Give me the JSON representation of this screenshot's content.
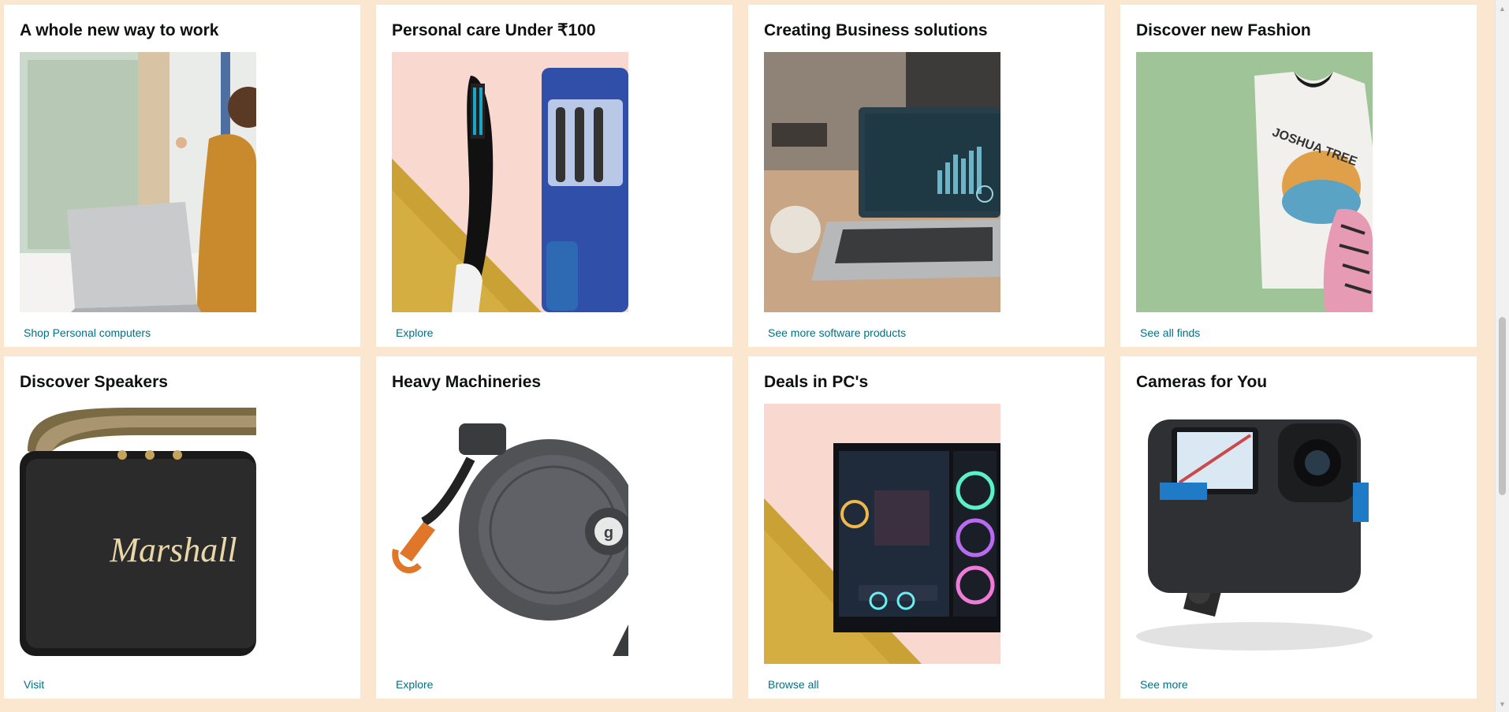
{
  "cards": [
    {
      "title": "A whole new way to work",
      "link": "Shop Personal computers",
      "image": "woman-working-on-laptop"
    },
    {
      "title": "Personal care Under ₹100",
      "link": "Explore",
      "image": "oral-b-toothbrush"
    },
    {
      "title": "Creating Business solutions",
      "link": "See more software products",
      "image": "laptop-with-dashboard"
    },
    {
      "title": "Discover new Fashion",
      "link": "See all finds",
      "image": "graphic-tshirt"
    },
    {
      "title": "Discover Speakers",
      "link": "Visit",
      "image": "marshall-speaker",
      "image_text": "Marshall"
    },
    {
      "title": "Heavy Machineries",
      "link": "Explore",
      "image": "hose-reel"
    },
    {
      "title": "Deals in PC's",
      "link": "Browse all",
      "image": "gaming-pc-case"
    },
    {
      "title": "Cameras for You",
      "link": "See more",
      "image": "action-camera"
    }
  ],
  "colors": {
    "page_background": "#fbe6cf",
    "card_background": "#ffffff",
    "link": "#007185",
    "title": "#0f1111"
  },
  "scrollbar": {
    "up_icon": "triangle-up-icon",
    "down_icon": "triangle-down-icon"
  }
}
